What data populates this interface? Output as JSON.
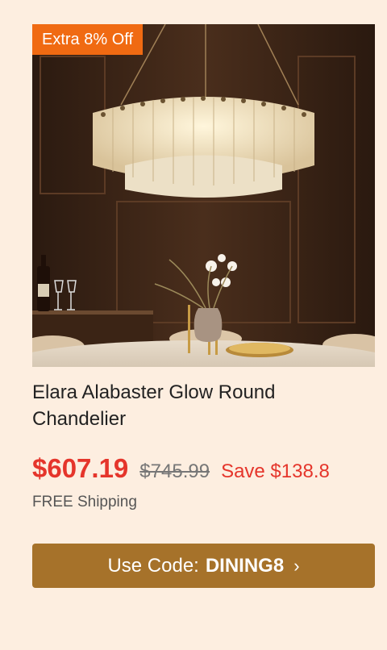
{
  "product": {
    "badge": "Extra 8% Off",
    "title": "Elara Alabaster Glow Round Chandelier",
    "price": "$607.19",
    "original_price": "$745.99",
    "savings": "Save $138.8",
    "shipping": "FREE Shipping"
  },
  "cta": {
    "label": "Use Code:",
    "code": "DINING8",
    "chevron": "›"
  },
  "colors": {
    "background": "#fdeee0",
    "badge": "#f06a12",
    "price": "#e5352b",
    "button": "#a6722a"
  }
}
